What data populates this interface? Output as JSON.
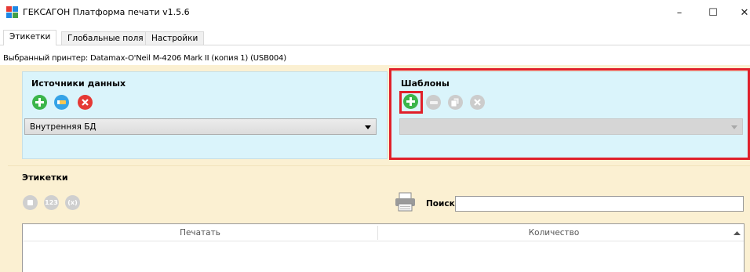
{
  "window": {
    "title": "ГЕКСАГОН Платформа печати  v1.5.6",
    "controls": {
      "minimize": "–",
      "maximize": "☐",
      "close": "✕"
    }
  },
  "tabs": [
    {
      "label": "Этикетки",
      "active": true
    },
    {
      "label": "Глобальные поля",
      "active": false
    },
    {
      "label": "Настройки",
      "active": false
    }
  ],
  "printer": {
    "label": "Выбранный принтер: Datamax-O'Neil M-4206 Mark II (копия 1) (USB004)"
  },
  "data_sources": {
    "title": "Источники данных",
    "buttons": [
      "add-icon",
      "edit-icon",
      "delete-icon"
    ],
    "selected": "Внутренняя БД"
  },
  "templates": {
    "title": "Шаблоны",
    "buttons": [
      "add-icon",
      "edit-icon",
      "copy-icon",
      "delete-icon"
    ],
    "selected": ""
  },
  "labels": {
    "title": "Этикетки",
    "tool_buttons": [
      "",
      "123",
      "(x)"
    ],
    "search_label": "Поиск",
    "search_value": "",
    "columns": [
      "Печатать",
      "Количество"
    ]
  },
  "colors": {
    "panel_blue": "#daf4fb",
    "panel_beige": "#fbf0d2",
    "green": "#3bb54a",
    "red": "#e53935",
    "blue": "#35a3e6",
    "highlight": "#e0202a"
  }
}
